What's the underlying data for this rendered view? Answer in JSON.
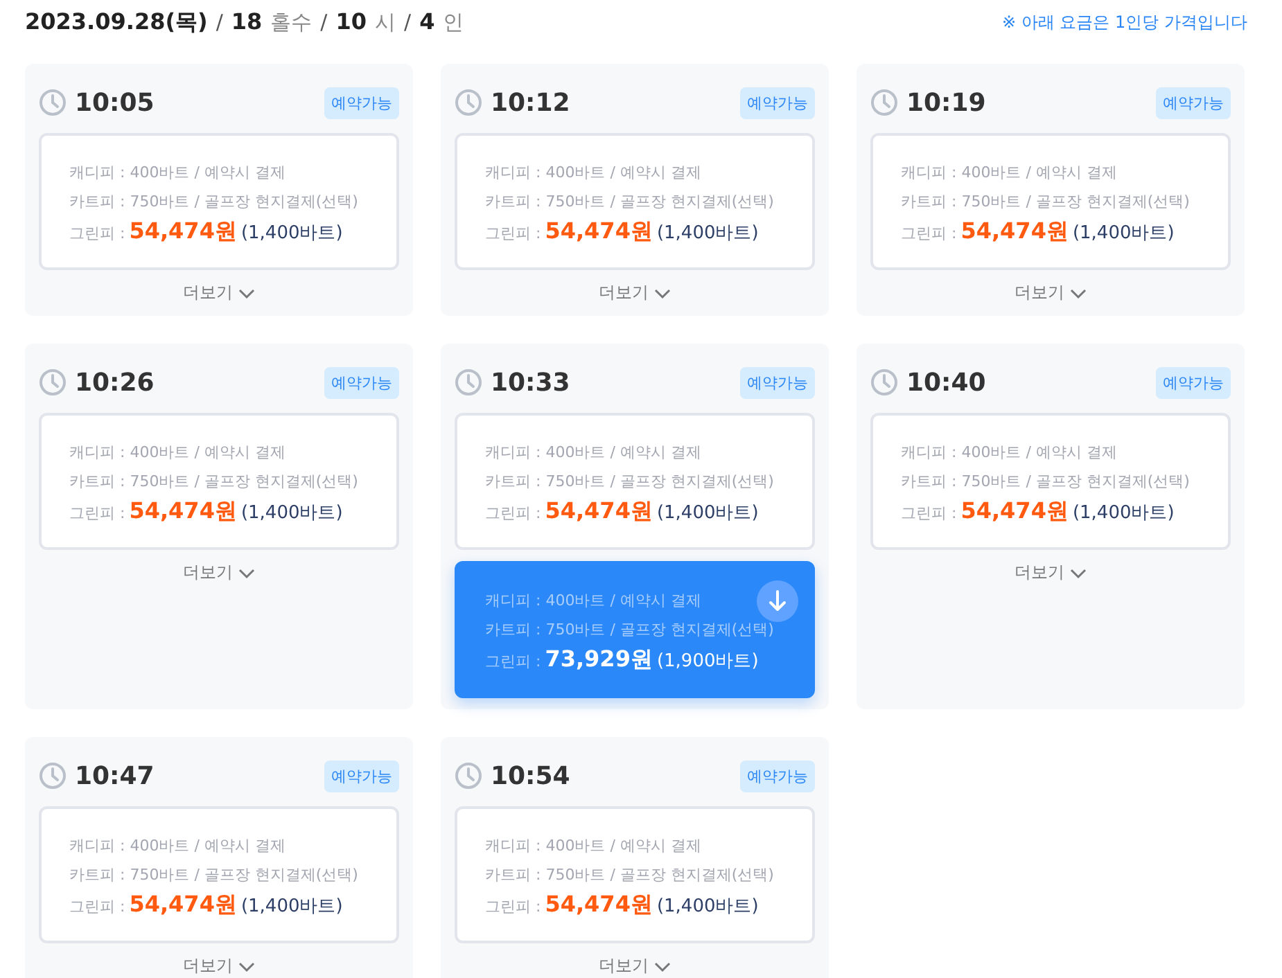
{
  "header": {
    "parts": [
      {
        "text": "2023.09.28(목)",
        "kind": "value"
      },
      {
        "text": "/",
        "kind": "sep"
      },
      {
        "text": "18",
        "kind": "value"
      },
      {
        "text": "홀수",
        "kind": "unit"
      },
      {
        "text": "/",
        "kind": "sep"
      },
      {
        "text": "10",
        "kind": "value"
      },
      {
        "text": "시",
        "kind": "unit"
      },
      {
        "text": "/",
        "kind": "sep"
      },
      {
        "text": "4",
        "kind": "value"
      },
      {
        "text": "인",
        "kind": "unit"
      }
    ],
    "note": "※ 아래 요금은 1인당 가격입니다"
  },
  "slots": [
    {
      "time": "10:05",
      "status": "예약가능",
      "more": "더보기",
      "options": [
        {
          "caddie": "캐디피 : 400바트 / 예약시 결제",
          "cart": "카트피 : 750바트 / 골프장 현지결제(선택)",
          "green_label": "그린피 :",
          "price": "54,474원",
          "baht": "(1,400바트)",
          "selected": false
        }
      ]
    },
    {
      "time": "10:12",
      "status": "예약가능",
      "more": "더보기",
      "options": [
        {
          "caddie": "캐디피 : 400바트 / 예약시 결제",
          "cart": "카트피 : 750바트 / 골프장 현지결제(선택)",
          "green_label": "그린피 :",
          "price": "54,474원",
          "baht": "(1,400바트)",
          "selected": false
        }
      ]
    },
    {
      "time": "10:19",
      "status": "예약가능",
      "more": "더보기",
      "options": [
        {
          "caddie": "캐디피 : 400바트 / 예약시 결제",
          "cart": "카트피 : 750바트 / 골프장 현지결제(선택)",
          "green_label": "그린피 :",
          "price": "54,474원",
          "baht": "(1,400바트)",
          "selected": false
        }
      ]
    },
    {
      "time": "10:26",
      "status": "예약가능",
      "more": "더보기",
      "options": [
        {
          "caddie": "캐디피 : 400바트 / 예약시 결제",
          "cart": "카트피 : 750바트 / 골프장 현지결제(선택)",
          "green_label": "그린피 :",
          "price": "54,474원",
          "baht": "(1,400바트)",
          "selected": false
        }
      ]
    },
    {
      "time": "10:33",
      "status": "예약가능",
      "options": [
        {
          "caddie": "캐디피 : 400바트 / 예약시 결제",
          "cart": "카트피 : 750바트 / 골프장 현지결제(선택)",
          "green_label": "그린피 :",
          "price": "54,474원",
          "baht": "(1,400바트)",
          "selected": false
        },
        {
          "caddie": "캐디피 : 400바트 / 예약시 결제",
          "cart": "카트피 : 750바트 / 골프장 현지결제(선택)",
          "green_label": "그린피 :",
          "price": "73,929원",
          "baht": "(1,900바트)",
          "selected": true
        }
      ]
    },
    {
      "time": "10:40",
      "status": "예약가능",
      "more": "더보기",
      "options": [
        {
          "caddie": "캐디피 : 400바트 / 예약시 결제",
          "cart": "카트피 : 750바트 / 골프장 현지결제(선택)",
          "green_label": "그린피 :",
          "price": "54,474원",
          "baht": "(1,400바트)",
          "selected": false
        }
      ]
    },
    {
      "time": "10:47",
      "status": "예약가능",
      "more": "더보기",
      "options": [
        {
          "caddie": "캐디피 : 400바트 / 예약시 결제",
          "cart": "카트피 : 750바트 / 골프장 현지결제(선택)",
          "green_label": "그린피 :",
          "price": "54,474원",
          "baht": "(1,400바트)",
          "selected": false
        }
      ]
    },
    {
      "time": "10:54",
      "status": "예약가능",
      "more": "더보기",
      "options": [
        {
          "caddie": "캐디피 : 400바트 / 예약시 결제",
          "cart": "카트피 : 750바트 / 골프장 현지결제(선택)",
          "green_label": "그린피 :",
          "price": "54,474원",
          "baht": "(1,400바트)",
          "selected": false
        }
      ]
    }
  ]
}
